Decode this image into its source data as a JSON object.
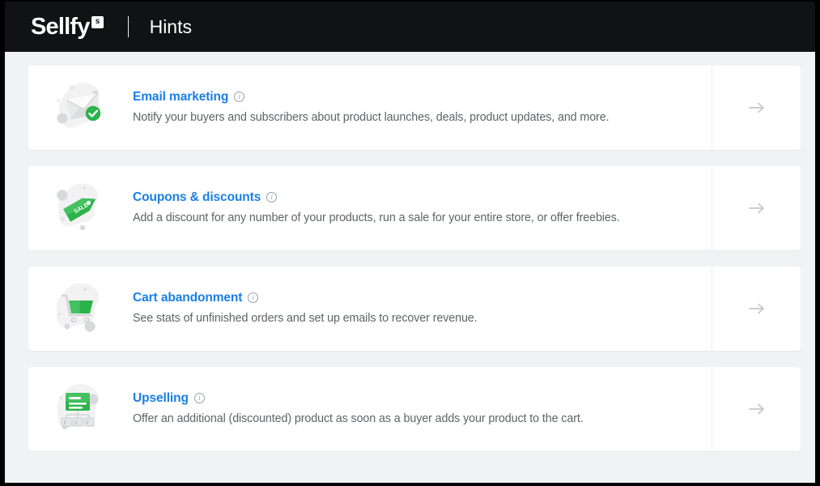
{
  "header": {
    "brand_name": "Sellfy",
    "brand_mark": "s",
    "separator": "|",
    "page_title": "Hints"
  },
  "colors": {
    "topbar_bg": "#111214",
    "page_bg": "#f1f2f3",
    "card_bg": "#ffffff",
    "title_link": "#1a7ee8",
    "description_text": "#5f6368",
    "accent_green": "#2cb34a",
    "arrow_gray": "#c6c8cb",
    "icon_blob_gray": "#f2f2f3"
  },
  "hints": [
    {
      "title": "Email marketing",
      "description": "Notify your buyers and subscribers about product launches, deals, product updates, and more.",
      "icon": "email-envelope-check-icon",
      "info_icon": "info-icon",
      "action_icon": "arrow-right-icon"
    },
    {
      "title": "Coupons & discounts",
      "description": "Add a discount for any number of your products, run a sale for your entire store, or offer freebies.",
      "icon": "sale-tag-icon",
      "icon_label": "SALE",
      "info_icon": "info-icon",
      "action_icon": "arrow-right-icon"
    },
    {
      "title": "Cart abandonment",
      "description": "See stats of unfinished orders and set up emails to recover revenue.",
      "icon": "shopping-cart-icon",
      "info_icon": "info-icon",
      "action_icon": "arrow-right-icon"
    },
    {
      "title": "Upselling",
      "description": "Offer an additional (discounted) product as soon as a buyer adds your product to the cart.",
      "icon": "upsell-hierarchy-icon",
      "info_icon": "info-icon",
      "action_icon": "arrow-right-icon"
    }
  ]
}
